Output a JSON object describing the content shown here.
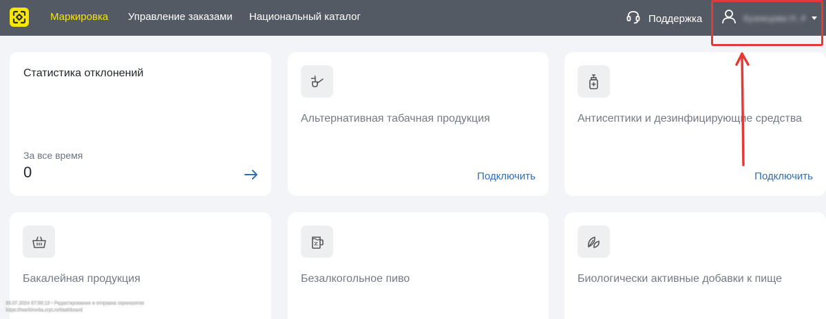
{
  "nav": {
    "items": [
      {
        "label": "Маркировка",
        "active": true
      },
      {
        "label": "Управление заказами",
        "active": false
      },
      {
        "label": "Национальный каталог",
        "active": false
      }
    ],
    "support_label": "Поддержка",
    "user_name": "Кузнецова Н. А."
  },
  "stats_card": {
    "title": "Статистика отклонений",
    "period_label": "За все время",
    "value": "0"
  },
  "product_cards": [
    {
      "title": "Альтернативная табачная продукция",
      "action": "Подключить",
      "icon": "pipe-icon"
    },
    {
      "title": "Антисептики и дезинфицирующие средства",
      "action": "Подключить",
      "icon": "sanitizer-bottle-icon"
    },
    {
      "title": "Бакалейная продукция",
      "action": "",
      "icon": "grocery-basket-icon"
    },
    {
      "title": "Безалкогольное пиво",
      "action": "",
      "icon": "beer-mug-icon"
    },
    {
      "title": "Биологически активные добавки к пище",
      "action": "",
      "icon": "leaves-icon"
    }
  ],
  "watermark": {
    "line1": "30.07.2024 07:58:13 • Редактирование и отправка скриншотов",
    "line2": "https://markirovka.crpt.ru/dashboard"
  },
  "colors": {
    "topbar": "#545a63",
    "brand_yellow": "#f6e600",
    "link_blue": "#2f6db5",
    "highlight_red": "#e53935",
    "page_bg": "#f2f4f7"
  }
}
